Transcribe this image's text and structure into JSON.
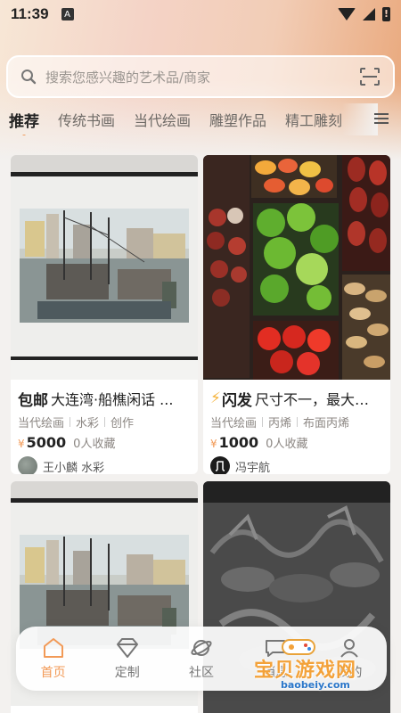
{
  "status_bar": {
    "time": "11:39",
    "notification_badge": "A"
  },
  "search": {
    "placeholder": "搜索您感兴趣的艺术品/商家"
  },
  "tabs": [
    {
      "label": "推荐",
      "active": true
    },
    {
      "label": "传统书画"
    },
    {
      "label": "当代绘画"
    },
    {
      "label": "雕塑作品"
    },
    {
      "label": "精工雕刻"
    }
  ],
  "products": [
    {
      "badge": "包邮",
      "title": "大连湾·船樵闲话 ...",
      "tags": [
        "当代绘画",
        "水彩",
        "创作"
      ],
      "price_symbol": "¥",
      "price": "5000",
      "collects": "0人收藏",
      "seller": "王小麟 水彩"
    },
    {
      "badge": "闪发",
      "title": "尺寸不一，最大…",
      "tags": [
        "当代绘画",
        "丙烯",
        "布面丙烯"
      ],
      "price_symbol": "¥",
      "price": "1000",
      "collects": "0人收藏",
      "seller": "冯宇航"
    }
  ],
  "bottom_nav": [
    {
      "label": "首页",
      "icon": "home-icon",
      "active": true
    },
    {
      "label": "定制",
      "icon": "diamond-icon"
    },
    {
      "label": "社区",
      "icon": "planet-icon"
    },
    {
      "label": "消息",
      "icon": "message-icon"
    },
    {
      "label": "我的",
      "icon": "profile-icon"
    }
  ],
  "watermark": {
    "text": "宝贝游戏网",
    "url": "baobeiy.com"
  },
  "colors": {
    "accent": "#f29a57",
    "badge_yellow": "#f5b43d"
  }
}
